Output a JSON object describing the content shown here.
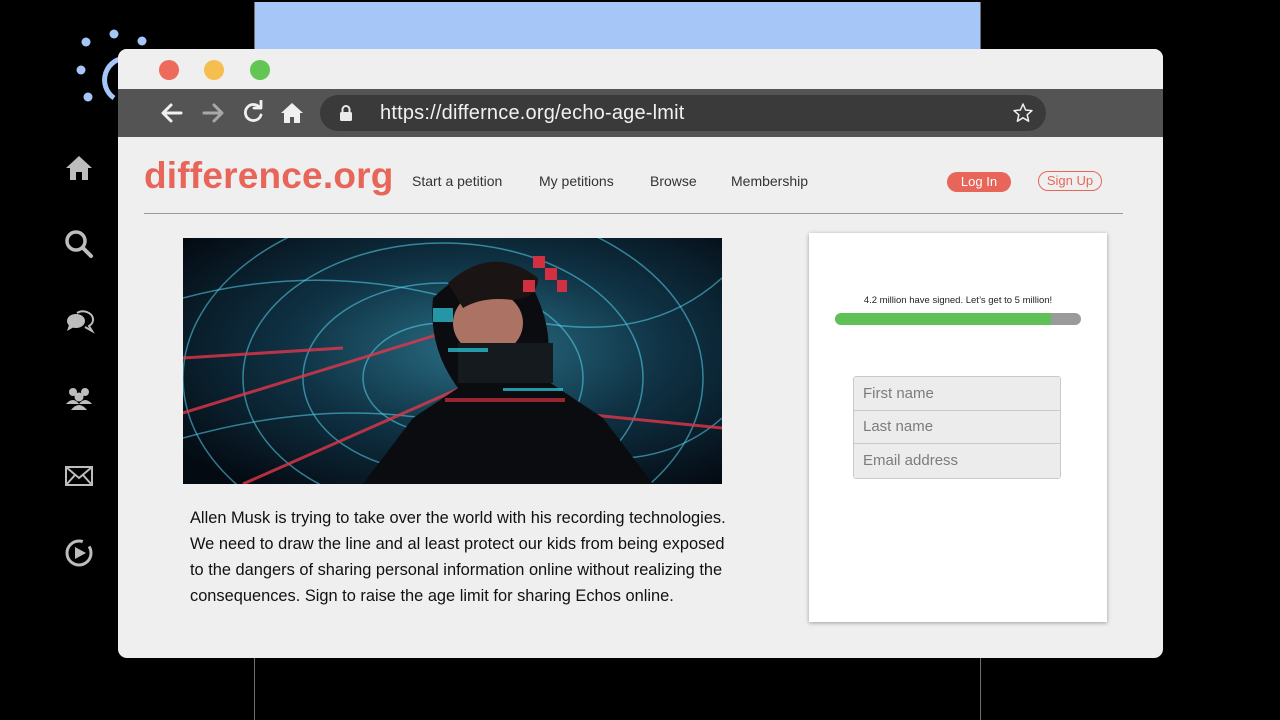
{
  "browser": {
    "url": "https://differnce.org/echo-age-lmit"
  },
  "site": {
    "brand": "difference.org",
    "nav": [
      "Start a petition",
      "My petitions",
      "Browse",
      "Membership"
    ],
    "login_label": "Log In",
    "signup_label": "Sign Up"
  },
  "petition": {
    "description": "Allen Musk is trying to take over the world with his recording technologies. We need to draw the line and al least protect our kids from being exposed to the dangers of sharing personal information online without realizing the consequences. Sign to raise the age limit for sharing Echos online.",
    "signature_status": "4.2 million have signed. Let’s get to 5 million!",
    "progress_fraction": 0.88
  },
  "form": {
    "first_name_placeholder": "First name",
    "last_name_placeholder": "Last name",
    "email_placeholder": "Email address"
  },
  "dock": {
    "icons": [
      "home-icon",
      "search-icon",
      "chat-icon",
      "people-icon",
      "mail-icon",
      "play-icon"
    ]
  },
  "colors": {
    "brand": "#e8655a",
    "progress": "#5ec056",
    "backdrop_panel": "#a6c6f7"
  }
}
